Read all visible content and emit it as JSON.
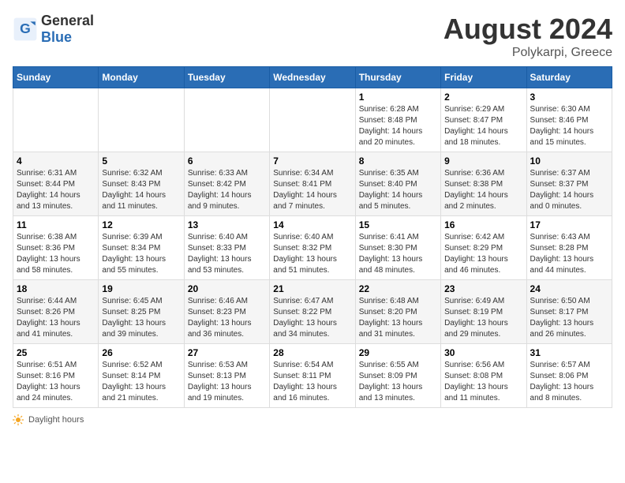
{
  "header": {
    "logo_general": "General",
    "logo_blue": "Blue",
    "month_year": "August 2024",
    "location": "Polykarpi, Greece"
  },
  "days_of_week": [
    "Sunday",
    "Monday",
    "Tuesday",
    "Wednesday",
    "Thursday",
    "Friday",
    "Saturday"
  ],
  "weeks": [
    [
      {
        "day": "",
        "info": ""
      },
      {
        "day": "",
        "info": ""
      },
      {
        "day": "",
        "info": ""
      },
      {
        "day": "",
        "info": ""
      },
      {
        "day": "1",
        "info": "Sunrise: 6:28 AM\nSunset: 8:48 PM\nDaylight: 14 hours\nand 20 minutes."
      },
      {
        "day": "2",
        "info": "Sunrise: 6:29 AM\nSunset: 8:47 PM\nDaylight: 14 hours\nand 18 minutes."
      },
      {
        "day": "3",
        "info": "Sunrise: 6:30 AM\nSunset: 8:46 PM\nDaylight: 14 hours\nand 15 minutes."
      }
    ],
    [
      {
        "day": "4",
        "info": "Sunrise: 6:31 AM\nSunset: 8:44 PM\nDaylight: 14 hours\nand 13 minutes."
      },
      {
        "day": "5",
        "info": "Sunrise: 6:32 AM\nSunset: 8:43 PM\nDaylight: 14 hours\nand 11 minutes."
      },
      {
        "day": "6",
        "info": "Sunrise: 6:33 AM\nSunset: 8:42 PM\nDaylight: 14 hours\nand 9 minutes."
      },
      {
        "day": "7",
        "info": "Sunrise: 6:34 AM\nSunset: 8:41 PM\nDaylight: 14 hours\nand 7 minutes."
      },
      {
        "day": "8",
        "info": "Sunrise: 6:35 AM\nSunset: 8:40 PM\nDaylight: 14 hours\nand 5 minutes."
      },
      {
        "day": "9",
        "info": "Sunrise: 6:36 AM\nSunset: 8:38 PM\nDaylight: 14 hours\nand 2 minutes."
      },
      {
        "day": "10",
        "info": "Sunrise: 6:37 AM\nSunset: 8:37 PM\nDaylight: 14 hours\nand 0 minutes."
      }
    ],
    [
      {
        "day": "11",
        "info": "Sunrise: 6:38 AM\nSunset: 8:36 PM\nDaylight: 13 hours\nand 58 minutes."
      },
      {
        "day": "12",
        "info": "Sunrise: 6:39 AM\nSunset: 8:34 PM\nDaylight: 13 hours\nand 55 minutes."
      },
      {
        "day": "13",
        "info": "Sunrise: 6:40 AM\nSunset: 8:33 PM\nDaylight: 13 hours\nand 53 minutes."
      },
      {
        "day": "14",
        "info": "Sunrise: 6:40 AM\nSunset: 8:32 PM\nDaylight: 13 hours\nand 51 minutes."
      },
      {
        "day": "15",
        "info": "Sunrise: 6:41 AM\nSunset: 8:30 PM\nDaylight: 13 hours\nand 48 minutes."
      },
      {
        "day": "16",
        "info": "Sunrise: 6:42 AM\nSunset: 8:29 PM\nDaylight: 13 hours\nand 46 minutes."
      },
      {
        "day": "17",
        "info": "Sunrise: 6:43 AM\nSunset: 8:28 PM\nDaylight: 13 hours\nand 44 minutes."
      }
    ],
    [
      {
        "day": "18",
        "info": "Sunrise: 6:44 AM\nSunset: 8:26 PM\nDaylight: 13 hours\nand 41 minutes."
      },
      {
        "day": "19",
        "info": "Sunrise: 6:45 AM\nSunset: 8:25 PM\nDaylight: 13 hours\nand 39 minutes."
      },
      {
        "day": "20",
        "info": "Sunrise: 6:46 AM\nSunset: 8:23 PM\nDaylight: 13 hours\nand 36 minutes."
      },
      {
        "day": "21",
        "info": "Sunrise: 6:47 AM\nSunset: 8:22 PM\nDaylight: 13 hours\nand 34 minutes."
      },
      {
        "day": "22",
        "info": "Sunrise: 6:48 AM\nSunset: 8:20 PM\nDaylight: 13 hours\nand 31 minutes."
      },
      {
        "day": "23",
        "info": "Sunrise: 6:49 AM\nSunset: 8:19 PM\nDaylight: 13 hours\nand 29 minutes."
      },
      {
        "day": "24",
        "info": "Sunrise: 6:50 AM\nSunset: 8:17 PM\nDaylight: 13 hours\nand 26 minutes."
      }
    ],
    [
      {
        "day": "25",
        "info": "Sunrise: 6:51 AM\nSunset: 8:16 PM\nDaylight: 13 hours\nand 24 minutes."
      },
      {
        "day": "26",
        "info": "Sunrise: 6:52 AM\nSunset: 8:14 PM\nDaylight: 13 hours\nand 21 minutes."
      },
      {
        "day": "27",
        "info": "Sunrise: 6:53 AM\nSunset: 8:13 PM\nDaylight: 13 hours\nand 19 minutes."
      },
      {
        "day": "28",
        "info": "Sunrise: 6:54 AM\nSunset: 8:11 PM\nDaylight: 13 hours\nand 16 minutes."
      },
      {
        "day": "29",
        "info": "Sunrise: 6:55 AM\nSunset: 8:09 PM\nDaylight: 13 hours\nand 13 minutes."
      },
      {
        "day": "30",
        "info": "Sunrise: 6:56 AM\nSunset: 8:08 PM\nDaylight: 13 hours\nand 11 minutes."
      },
      {
        "day": "31",
        "info": "Sunrise: 6:57 AM\nSunset: 8:06 PM\nDaylight: 13 hours\nand 8 minutes."
      }
    ]
  ],
  "footer": {
    "daylight_label": "Daylight hours"
  }
}
